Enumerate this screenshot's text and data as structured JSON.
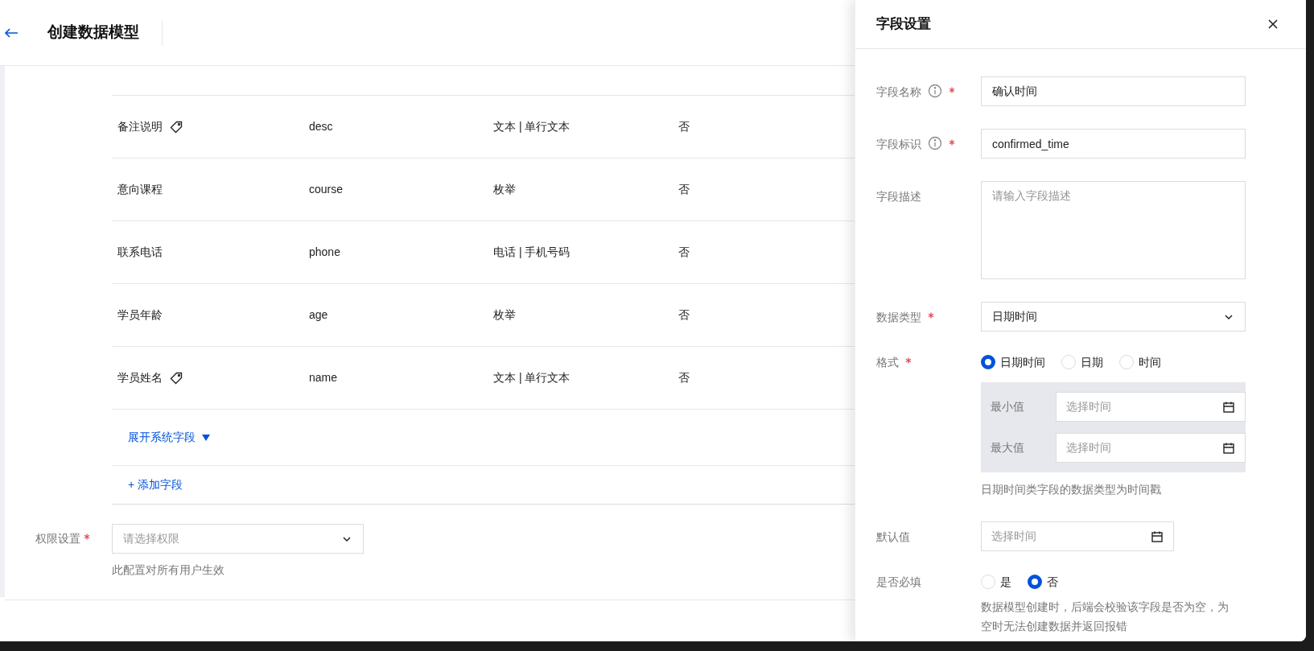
{
  "header": {
    "title": "创建数据模型"
  },
  "fields_table": {
    "rows": [
      {
        "name": "备注说明",
        "tagged": true,
        "identifier": "desc",
        "type": "文本 | 单行文本",
        "required": "否"
      },
      {
        "name": "意向课程",
        "tagged": false,
        "identifier": "course",
        "type": "枚举",
        "required": "否"
      },
      {
        "name": "联系电话",
        "tagged": false,
        "identifier": "phone",
        "type": "电话 | 手机号码",
        "required": "否"
      },
      {
        "name": "学员年龄",
        "tagged": false,
        "identifier": "age",
        "type": "枚举",
        "required": "否"
      },
      {
        "name": "学员姓名",
        "tagged": true,
        "identifier": "name",
        "type": "文本 | 单行文本",
        "required": "否"
      }
    ],
    "expand_link": "展开系统字段",
    "add_link": "+ 添加字段"
  },
  "permission": {
    "label": "权限设置",
    "required": true,
    "placeholder": "请选择权限",
    "hint": "此配置对所有用户生效"
  },
  "drawer": {
    "title": "字段设置",
    "form": [
      {
        "kind": "input",
        "label": "字段名称",
        "info": true,
        "required": true,
        "value": "确认时间"
      },
      {
        "kind": "input",
        "label": "字段标识",
        "info": true,
        "required": true,
        "value": "confirmed_time"
      },
      {
        "kind": "textarea",
        "label": "字段描述",
        "info": false,
        "required": false,
        "placeholder": "请输入字段描述"
      },
      {
        "kind": "select",
        "label": "数据类型",
        "info": false,
        "required": true,
        "value": "日期时间"
      },
      {
        "kind": "radio",
        "label": "格式",
        "info": false,
        "required": true,
        "options": [
          {
            "label": "日期时间",
            "selected": true
          },
          {
            "label": "日期",
            "selected": false
          },
          {
            "label": "时间",
            "selected": false
          }
        ],
        "range": [
          {
            "label": "最小值",
            "placeholder": "选择时间"
          },
          {
            "label": "最大值",
            "placeholder": "选择时间"
          }
        ],
        "hint": "日期时间类字段的数据类型为时间戳"
      },
      {
        "kind": "date",
        "label": "默认值",
        "info": false,
        "required": false,
        "placeholder": "选择时间"
      },
      {
        "kind": "radio",
        "label": "是否必填",
        "info": false,
        "required": false,
        "options": [
          {
            "label": "是",
            "selected": false
          },
          {
            "label": "否",
            "selected": true
          }
        ],
        "hint": "数据模型创建时，后端会校验该字段是否为空，为空时无法创建数据并返回报错"
      }
    ]
  }
}
